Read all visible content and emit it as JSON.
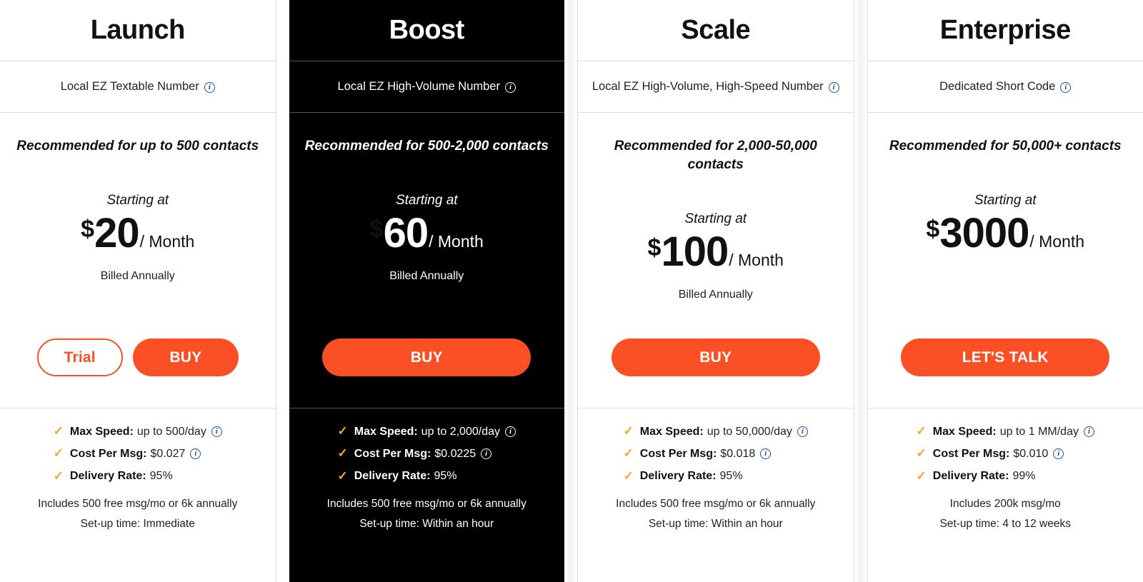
{
  "theme": {
    "accent": "#fb4f26",
    "check_color": "#f5a623",
    "info_color": "#1c4fa1",
    "featured_bg": "#000000"
  },
  "plans": [
    {
      "id": "launch",
      "name": "Launch",
      "subtitle": "Local EZ Textable Number",
      "subtitle_info_icon": "info-icon",
      "recommended": "Recommended for up to 500 contacts",
      "starting_at": "Starting at",
      "currency": "$",
      "price": "20",
      "period": "/ Month",
      "billed": "Billed Annually",
      "buttons": [
        {
          "label": "Trial",
          "style": "outline"
        },
        {
          "label": "BUY",
          "style": "solid"
        }
      ],
      "features": [
        {
          "label": "Max Speed:",
          "value": "up to 500/day",
          "info": true
        },
        {
          "label": "Cost Per Msg:",
          "value": "$0.027",
          "info": true
        },
        {
          "label": "Delivery Rate:",
          "value": "95%",
          "info": false
        }
      ],
      "notes": [
        "Includes 500 free msg/mo or 6k annually",
        "Set-up time: Immediate"
      ],
      "featured": false
    },
    {
      "id": "boost",
      "name": "Boost",
      "subtitle": "Local EZ High-Volume Number",
      "subtitle_info_icon": "info-icon",
      "recommended": "Recommended for 500-2,000 contacts",
      "starting_at": "Starting at",
      "currency": "$",
      "price": "60",
      "period": "/ Month",
      "billed": "Billed Annually",
      "buttons": [
        {
          "label": "BUY",
          "style": "solid-full"
        }
      ],
      "features": [
        {
          "label": "Max Speed:",
          "value": "up to 2,000/day",
          "info": true
        },
        {
          "label": "Cost Per Msg:",
          "value": "$0.0225",
          "info": true
        },
        {
          "label": "Delivery Rate:",
          "value": "95%",
          "info": false
        }
      ],
      "notes": [
        "Includes 500 free msg/mo or 6k annually",
        "Set-up time: Within an hour"
      ],
      "featured": true
    },
    {
      "id": "scale",
      "name": "Scale",
      "subtitle": "Local EZ High-Volume, High-Speed Number",
      "subtitle_info_icon": "info-icon",
      "recommended": "Recommended for 2,000-50,000 contacts",
      "starting_at": "Starting at",
      "currency": "$",
      "price": "100",
      "period": "/ Month",
      "billed": "Billed Annually",
      "buttons": [
        {
          "label": "BUY",
          "style": "solid-full"
        }
      ],
      "features": [
        {
          "label": "Max Speed:",
          "value": "up to 50,000/day",
          "info": true
        },
        {
          "label": "Cost Per Msg:",
          "value": "$0.018",
          "info": true
        },
        {
          "label": "Delivery Rate:",
          "value": "95%",
          "info": false
        }
      ],
      "notes": [
        "Includes 500 free msg/mo or 6k annually",
        "Set-up time: Within an hour"
      ],
      "featured": false
    },
    {
      "id": "enterprise",
      "name": "Enterprise",
      "subtitle": "Dedicated Short Code",
      "subtitle_info_icon": "info-icon",
      "recommended": "Recommended for 50,000+ contacts",
      "starting_at": "Starting at",
      "currency": "$",
      "price": "3000",
      "period": "/ Month",
      "billed": "",
      "buttons": [
        {
          "label": "LET'S TALK",
          "style": "solid-full"
        }
      ],
      "features": [
        {
          "label": "Max Speed:",
          "value": "up to 1 MM/day",
          "info": true
        },
        {
          "label": "Cost Per Msg:",
          "value": "$0.010",
          "info": true
        },
        {
          "label": "Delivery Rate:",
          "value": "99%",
          "info": false
        }
      ],
      "notes": [
        "Includes 200k msg/mo",
        "Set-up time: 4 to 12 weeks"
      ],
      "featured": false
    }
  ]
}
